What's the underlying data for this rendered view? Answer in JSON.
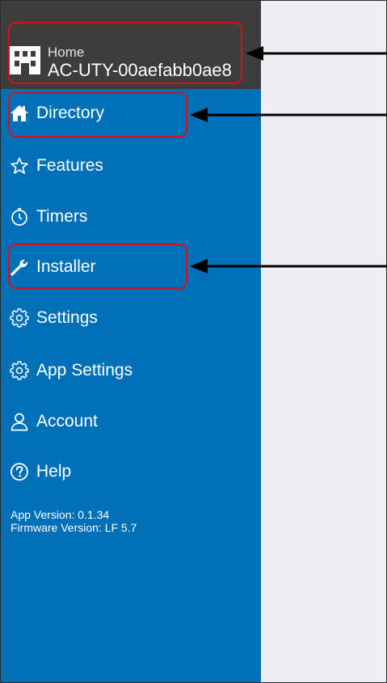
{
  "header": {
    "subtitle": "Home",
    "device_name": "AC-UTY-00aefabb0ae8",
    "icon": "building-icon"
  },
  "menu": [
    {
      "label": "Directory",
      "icon": "home-icon"
    },
    {
      "label": "Features",
      "icon": "star-icon"
    },
    {
      "label": "Timers",
      "icon": "timer-icon"
    },
    {
      "label": "Installer",
      "icon": "wrench-icon"
    },
    {
      "label": "Settings",
      "icon": "gear-icon"
    },
    {
      "label": "App Settings",
      "icon": "gear-icon"
    },
    {
      "label": "Account",
      "icon": "user-icon"
    },
    {
      "label": "Help",
      "icon": "help-icon"
    }
  ],
  "footer": {
    "app_version": "App Version: 0.1.34",
    "firmware_version": "Firmware Version: LF 5.7"
  },
  "colors": {
    "drawer_background": "#0070b8",
    "header_background": "#3d3d3d",
    "content_background": "#efeef4",
    "annotation_red": "#d90f16"
  }
}
